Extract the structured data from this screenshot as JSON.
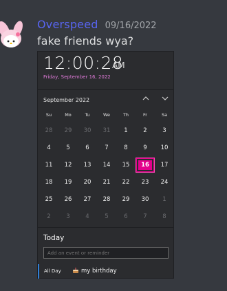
{
  "message": {
    "username": "Overspeed",
    "timestamp": "09/16/2022",
    "text": "fake friends wya?"
  },
  "colors": {
    "background": "#36393f",
    "username": "#5865f2",
    "panel": "#2b2c2f",
    "accent_today": "#e4008c",
    "date_accent": "#e07bd9",
    "agenda_bar": "#2f7fd6"
  },
  "clock": {
    "time": "12:00:28",
    "ampm": "AM",
    "full_date": "Friday, September 16, 2022"
  },
  "calendar": {
    "month_label": "September 2022",
    "prev_icon": "chevron-up-icon",
    "next_icon": "chevron-down-icon",
    "weekdays": [
      "Su",
      "Mo",
      "Tu",
      "We",
      "Th",
      "Fr",
      "Sa"
    ],
    "weeks": [
      [
        "28",
        "29",
        "30",
        "31",
        "1",
        "2",
        "3"
      ],
      [
        "4",
        "5",
        "6",
        "7",
        "8",
        "9",
        "10"
      ],
      [
        "11",
        "12",
        "13",
        "14",
        "15",
        "16",
        "17"
      ],
      [
        "18",
        "19",
        "20",
        "21",
        "22",
        "23",
        "24"
      ],
      [
        "25",
        "26",
        "27",
        "28",
        "29",
        "30",
        "1"
      ],
      [
        "2",
        "3",
        "4",
        "5",
        "6",
        "7",
        "8"
      ]
    ],
    "selected_day": "16"
  },
  "agenda": {
    "title": "Today",
    "input_placeholder": "Add an event or reminder",
    "events": [
      {
        "when": "All Day",
        "icon": "birthday-cake-icon",
        "title": "my birthday"
      }
    ]
  }
}
